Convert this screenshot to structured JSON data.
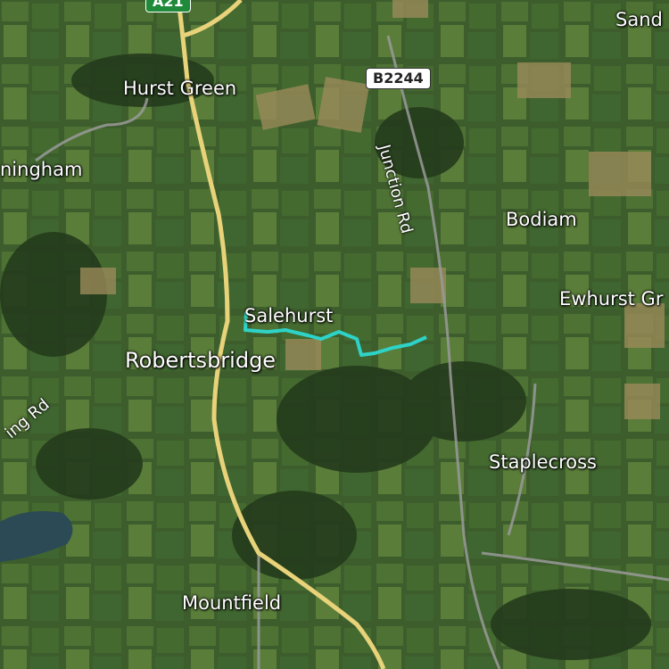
{
  "map": {
    "type": "satellite",
    "route_color": "#2ed3c8",
    "colors": {
      "main_road": "#e8d27a",
      "minor_road": "#9a9a9a"
    },
    "places": {
      "sand": "Sand",
      "hurst_green": "Hurst Green",
      "ningham": "ningham",
      "bodiam": "Bodiam",
      "ewhurst": "Ewhurst Gr",
      "salehurst": "Salehurst",
      "robertsbridge": "Robertsbridge",
      "staplecross": "Staplecross",
      "mountfield": "Mountfield"
    },
    "roads": {
      "b2244": "B2244",
      "junction_rd": "Junction Rd",
      "ing_rd": "ing Rd",
      "a_shield": "A21"
    }
  }
}
